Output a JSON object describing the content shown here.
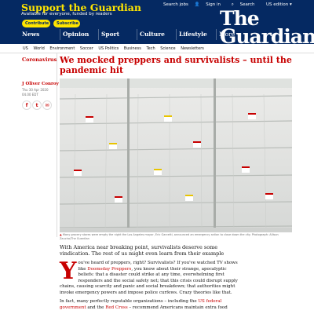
{
  "header": {
    "support_title": "Support the Guardian",
    "support_subtitle": "Available for everyone, funded by readers",
    "contribute_label": "Contribute",
    "subscribe_label": "Subscribe",
    "search_jobs": "Search jobs",
    "sign_in": "Sign in",
    "search": "Search",
    "edition": "US edition",
    "logo_the": "The",
    "logo_guardian": "Guardian",
    "arrow": "→"
  },
  "nav": {
    "items": [
      "News",
      "Opinion",
      "Sport",
      "Culture",
      "Lifestyle"
    ],
    "more": "More"
  },
  "subnav": {
    "items": [
      "US",
      "World",
      "Environment",
      "Soccer",
      "US Politics",
      "Business",
      "Tech",
      "Science",
      "Newsletters"
    ]
  },
  "article": {
    "section": "Coronavirus",
    "headline": "We mocked preppers and survivalists – until the pandemic hit",
    "byline": "J Oliver Conroy",
    "date": "Thu 30 Apr 2020 04.00 EDT",
    "caption": "Many grocery stores were empty the night the Los Angeles mayor, Eric Garcetti, announced an emergency action to close down the city. Photograph: Allison Zaucha/The Guardian",
    "standfirst": "With America near breaking point, survivalists deserve some vindication. The rest of us might even learn from their example",
    "dropcap": "Y",
    "para1_start": "ou've heard of preppers, right? Survivalists? If you've watched TV shows like ",
    "para1_link": "Doomsday Preppers",
    "para1_end": ", you know about their strange, apocalyptic beliefs: that a disaster could strike at any time, overwhelming first responders and the social safety net; that this crisis could disrupt supply chains, causing scarcity and panic and social breakdown; that authorities might invoke emergency powers and impose police curfews. Crazy theories like that.",
    "para2_start": "In fact, many perfectly reputable organizations – including the ",
    "para2_link1": "US federal government",
    "para2_mid": " and the ",
    "para2_link2": "Red Cross",
    "para2_end": " – recommend Americans maintain extra food"
  },
  "share": {
    "facebook": "f",
    "twitter": "t",
    "email": "✉"
  },
  "colors": {
    "brand_blue": "#052962",
    "support_yellow": "#ffe500",
    "news_red": "#c70000"
  }
}
